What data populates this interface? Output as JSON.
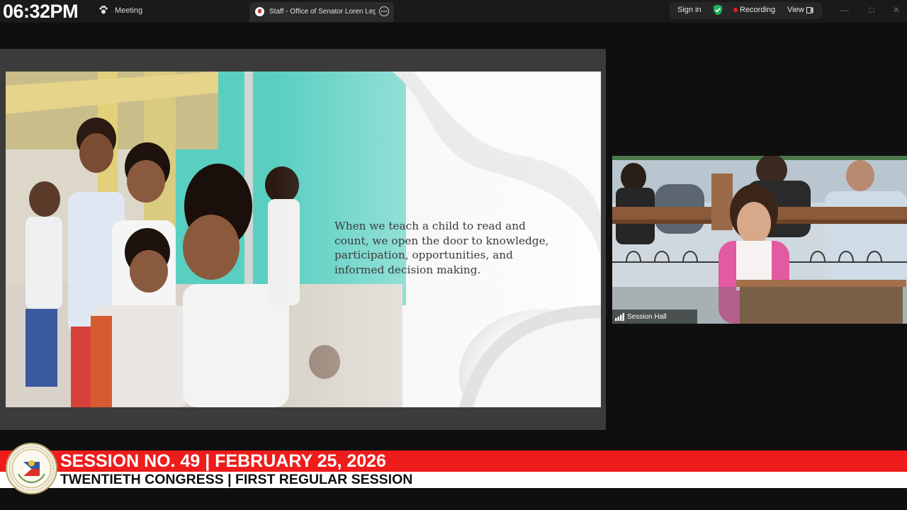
{
  "topbar": {
    "clock": "06:32PM",
    "meeting_label": "Meeting",
    "tab_title": "Staff - Office of Senator Loren Legarda",
    "sign_in": "Sign in",
    "recording": "Recording",
    "view": "View",
    "icons": [
      "paw-icon",
      "tab-favicon-icon",
      "more-options-icon",
      "shield-check-icon",
      "recording-dot-icon",
      "view-layout-icon",
      "minimize-icon",
      "maximize-icon",
      "close-icon"
    ]
  },
  "slide": {
    "quote_lines": [
      "When we teach a child to read and",
      "count, we open the door to knowledge,",
      "participation, opportunities, and",
      "informed decision making."
    ]
  },
  "video": {
    "participant_label": "Session Hall"
  },
  "lower_third": {
    "line1": "SESSION NO. 49 | FEBRUARY 25, 2026",
    "line2": "TWENTIETH CONGRESS | FIRST REGULAR SESSION",
    "colors": {
      "band": "#ef1c1c",
      "sub_band": "#ffffff"
    }
  }
}
